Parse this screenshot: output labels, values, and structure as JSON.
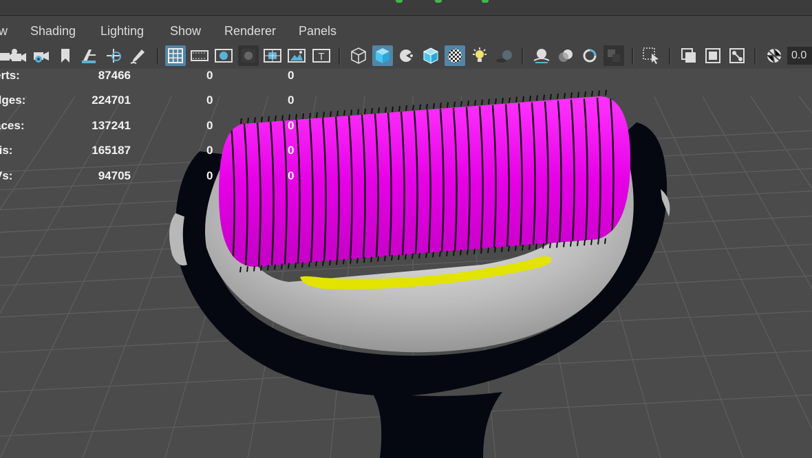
{
  "menu": {
    "items": [
      "w",
      "Shading",
      "Lighting",
      "Show",
      "Renderer",
      "Panels"
    ]
  },
  "toolbar": {
    "icons": [
      "select-camera-icon",
      "camera-attributes-icon",
      "camera-settings-icon",
      "bookmark-icon",
      "image-plane-icon",
      "pan-zoom-icon",
      "grease-pencil-icon",
      "grid-icon",
      "film-gate-icon",
      "resolution-gate-icon",
      "gate-mask-icon",
      "field-chart-icon",
      "safe-action-icon",
      "safe-title-icon",
      "wireframe-icon",
      "smooth-shade-icon",
      "use-default-material-icon",
      "wireframe-on-shaded-icon",
      "textured-icon",
      "use-all-lights-icon",
      "shadows-icon",
      "screen-space-ao-icon",
      "motion-blur-icon",
      "anti-aliasing-icon",
      "depth-of-field-icon",
      "isolate-select-icon",
      "xray-icon",
      "xray-active-components-icon",
      "xray-joints-icon",
      "exposure-icon"
    ],
    "exposure_value": "0.0"
  },
  "hud": {
    "rows": [
      {
        "label": "erts:",
        "total": "87466",
        "selected": "0",
        "selected_2": "0"
      },
      {
        "label": "dges:",
        "total": "224701",
        "selected": "0",
        "selected_2": "0"
      },
      {
        "label": "aces:",
        "total": "137241",
        "selected": "0",
        "selected_2": "0"
      },
      {
        "label": "ris:",
        "total": "165187",
        "selected": "0",
        "selected_2": "0"
      },
      {
        "label": "Vs:",
        "total": "94705",
        "selected": "0",
        "selected_2": "0"
      }
    ]
  },
  "colors": {
    "roller": "#e600e6",
    "highlight_strip": "#e3e300",
    "handle_shell": "#050810",
    "handle_inner": "#c4c4c4",
    "active_button": "#5285a6"
  }
}
